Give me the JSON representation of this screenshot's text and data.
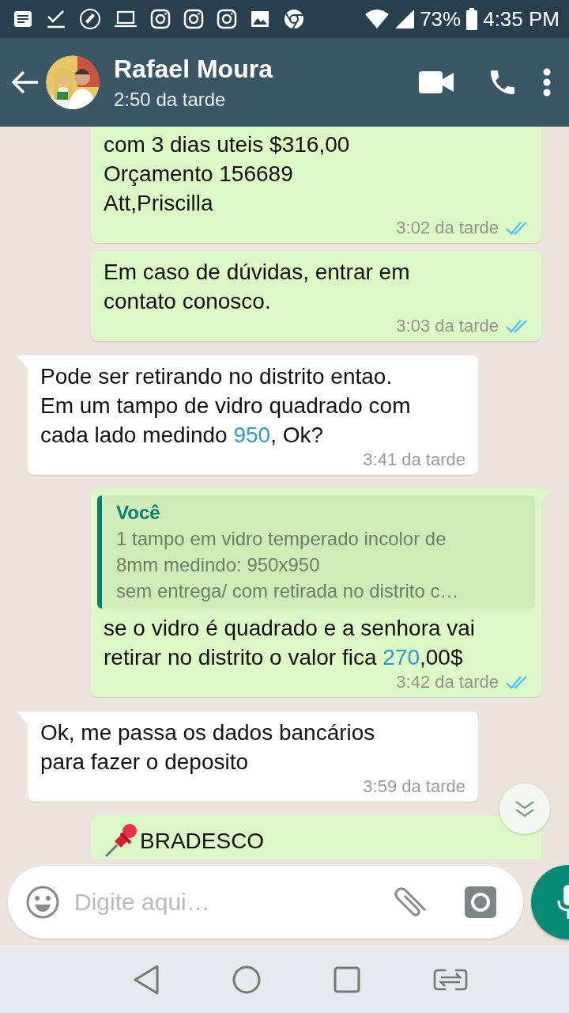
{
  "status_bar": {
    "battery": "73%",
    "time": "4:35 PM"
  },
  "header": {
    "name": "Rafael Moura",
    "subtitle": "2:50 da tarde"
  },
  "messages": [
    {
      "outgoing": true,
      "clipped_top": true,
      "tail": false,
      "segments": [
        {
          "kind": "text",
          "text": "com 3 dias uteis $316,00\nOrçamento 156689\nAtt,Priscilla"
        }
      ],
      "time": "3:02 da tarde",
      "read": true
    },
    {
      "outgoing": true,
      "tail": false,
      "segments": [
        {
          "kind": "text",
          "text": "Em caso de dúvidas, entrar em\ncontato conosco."
        }
      ],
      "time": "3:03 da tarde",
      "read": true
    },
    {
      "outgoing": false,
      "tail": true,
      "segments": [
        {
          "kind": "text",
          "text": "Pode ser retirando no distrito entao.\nEm um tampo de vidro quadrado com\ncada lado medindo "
        },
        {
          "kind": "number",
          "text": "950"
        },
        {
          "kind": "text",
          "text": ", Ok?"
        }
      ],
      "time": "3:41 da tarde"
    },
    {
      "outgoing": true,
      "tail": true,
      "quote": {
        "sender": "Você",
        "text": "1 tampo em vidro temperado incolor de\n8mm medindo: 950x950\nsem entrega/ com retirada no distrito c…"
      },
      "segments": [
        {
          "kind": "text",
          "text": "se o vidro é quadrado e a senhora vai\nretirar no distrito o valor fica "
        },
        {
          "kind": "number",
          "text": "270"
        },
        {
          "kind": "text",
          "text": ",00$"
        }
      ],
      "time": "3:42 da tarde",
      "read": true
    },
    {
      "outgoing": false,
      "tail": true,
      "segments": [
        {
          "kind": "text",
          "text": "Ok, me passa os dados bancários\npara fazer o deposito"
        }
      ],
      "time": "3:59 da tarde"
    },
    {
      "outgoing": true,
      "tail": false,
      "segments": [
        {
          "kind": "pin_emoji"
        },
        {
          "kind": "text",
          "text": "BRADESCO"
        }
      ]
    }
  ],
  "composer": {
    "placeholder": "Digite aqui…"
  }
}
